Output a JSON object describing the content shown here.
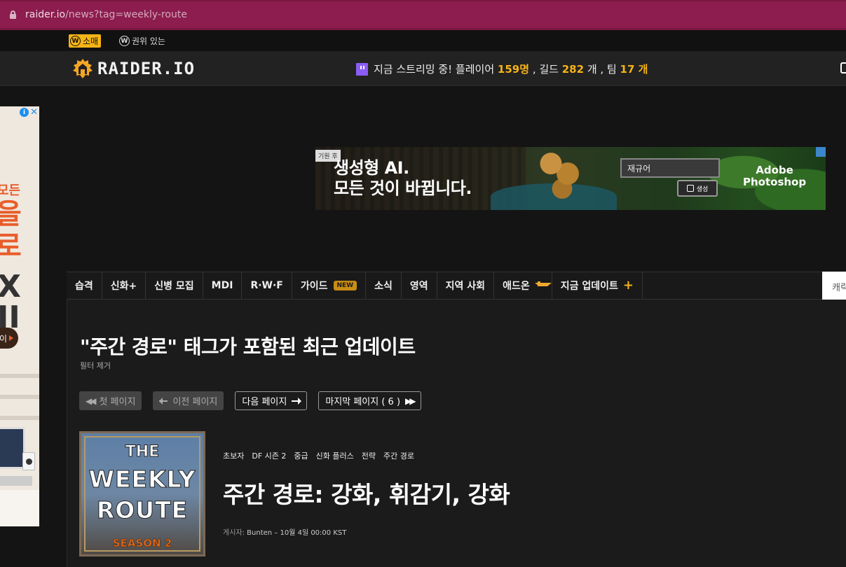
{
  "browser": {
    "url_host": "raider.io",
    "url_path": "/news?tag=weekly-route"
  },
  "regions": {
    "classic_icon": "W",
    "classic_label": "소매",
    "retail_icon": "W",
    "retail_label": "권위 있는"
  },
  "header": {
    "logo_text": "RAIDER.IO",
    "stream": {
      "prefix": "지금 스트리밍 중! 플레이어",
      "players": "159명",
      "guild_sep": ", 길드",
      "guilds": "282",
      "team_sep": "개 , 팀",
      "teams": "17 개"
    }
  },
  "side_ad": {
    "line1": "모든",
    "line2": "을",
    "line3": "로",
    "line4": "X II",
    "pill": "이"
  },
  "banner_ad": {
    "sponsor": "기원 후",
    "headline_1": "생성형 AI.",
    "headline_2": "모든 것이 바뀝니다.",
    "prompt": "재규어",
    "generate_label": "생성",
    "brand_1": "Adobe",
    "brand_2": "Photoshop"
  },
  "nav": {
    "items": [
      {
        "label": "습격"
      },
      {
        "label": "신화+"
      },
      {
        "label": "신병 모집"
      },
      {
        "label": "MDI"
      },
      {
        "label": "R·W·F"
      },
      {
        "label": "가이드",
        "badge": "NEW"
      },
      {
        "label": "소식"
      },
      {
        "label": "영역"
      },
      {
        "label": "지역 사회"
      },
      {
        "label": "애드온"
      },
      {
        "label": "지금 업데이트"
      }
    ],
    "search_placeholder": "캐릭"
  },
  "page": {
    "title": "\"주간 경로\" 태그가 포함된 최근 업데이트",
    "filter_clear": "필터 제거"
  },
  "pager": {
    "first": "첫 페이지",
    "prev": "이전 페이지",
    "next": "다음 페이지",
    "last": "마지막 페이지 ( 6 )"
  },
  "article": {
    "thumb": {
      "the": "THE",
      "weekly": "WEEKLY",
      "route": "ROUTE",
      "season": "SEASON 2"
    },
    "tags": [
      "초보자",
      "DF 시즌 2",
      "중급",
      "신화 플러스",
      "전략",
      "주간 경로"
    ],
    "title": "주간 경로: 강화, 휘감기, 강화",
    "byline_label": "게시자:",
    "byline_text": "Bunten – 10월 4일 00:00 KST"
  },
  "colors": {
    "accent": "#f5b316",
    "browser_bar": "#8c1d4e",
    "background": "#141414",
    "nav_background": "#191919",
    "twitch": "#8a5cf6"
  }
}
